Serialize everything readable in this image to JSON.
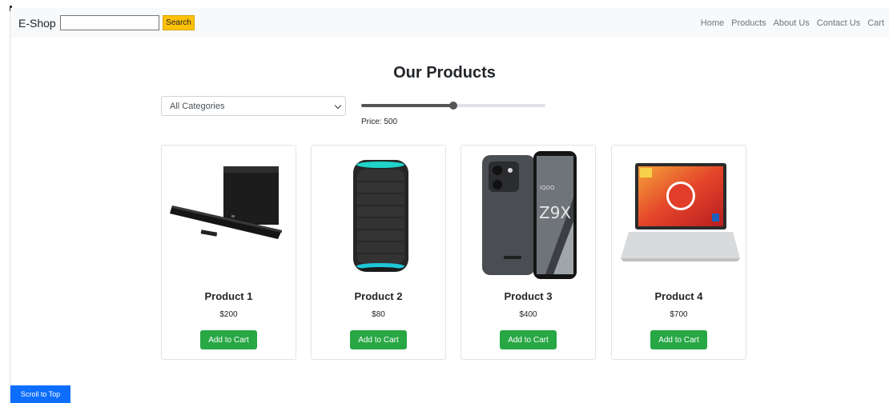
{
  "navbar": {
    "brand": "E-Shop",
    "search_placeholder": "",
    "search_value": "",
    "search_button": "Search",
    "links": [
      "Home",
      "Products",
      "About Us",
      "Contact Us",
      "Cart"
    ]
  },
  "main": {
    "title": "Our Products",
    "category_select": {
      "selected": "All Categories"
    },
    "price_filter": {
      "label": "Price: 500",
      "fill_fraction": 0.5
    }
  },
  "products": [
    {
      "name": "Product 1",
      "price": "$200",
      "button": "Add to Cart",
      "image": "soundbar-image"
    },
    {
      "name": "Product 2",
      "price": "$80",
      "button": "Add to Cart",
      "image": "speaker-image"
    },
    {
      "name": "Product 3",
      "price": "$400",
      "button": "Add to Cart",
      "image": "smartphone-image"
    },
    {
      "name": "Product 4",
      "price": "$700",
      "button": "Add to Cart",
      "image": "laptop-image"
    }
  ],
  "scroll_top_label": "Scroll to Top",
  "colors": {
    "search_button": "#ffc107",
    "add_to_cart": "#28a745",
    "scroll_top": "#0d6efd",
    "navbar_bg": "#f8f9fa"
  }
}
